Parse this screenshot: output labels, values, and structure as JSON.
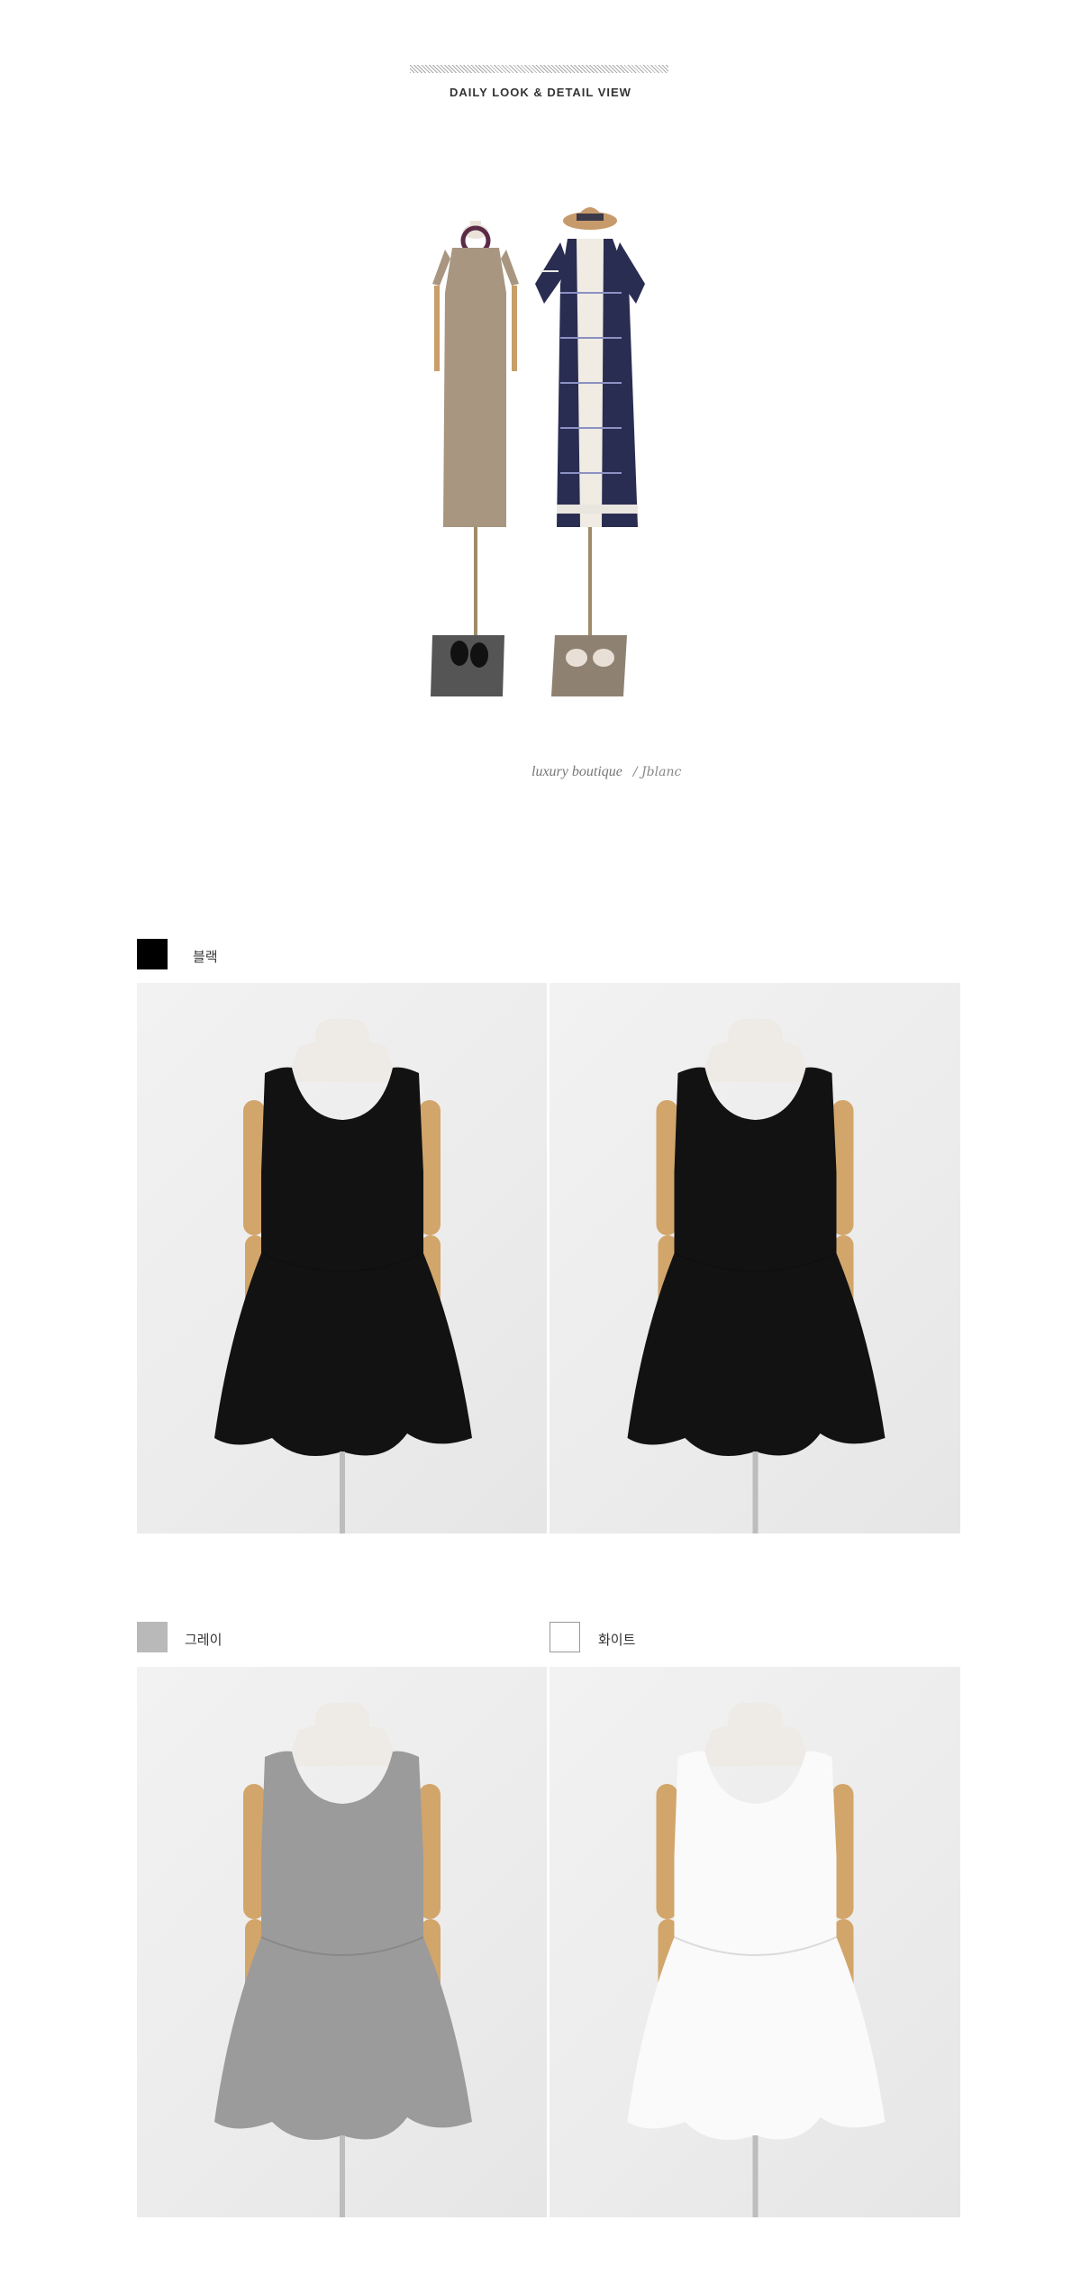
{
  "header": {
    "title": "DAILY LOOK & DETAIL VIEW"
  },
  "signature": {
    "text": "luxury boutique",
    "script": "/ Jblanc"
  },
  "colors": [
    {
      "name": "블랙",
      "hex": "#000000",
      "dress": "#121212"
    },
    {
      "name": "그레이",
      "hex": "#b9b9b9",
      "dress": "#9b9b9b"
    },
    {
      "name": "화이트",
      "hex": "#ffffff",
      "dress": "#fafafa"
    }
  ],
  "palette": {
    "wood": "#d2a56b",
    "mannequin": "#eeeae6",
    "stand": "#bdbdbd"
  }
}
